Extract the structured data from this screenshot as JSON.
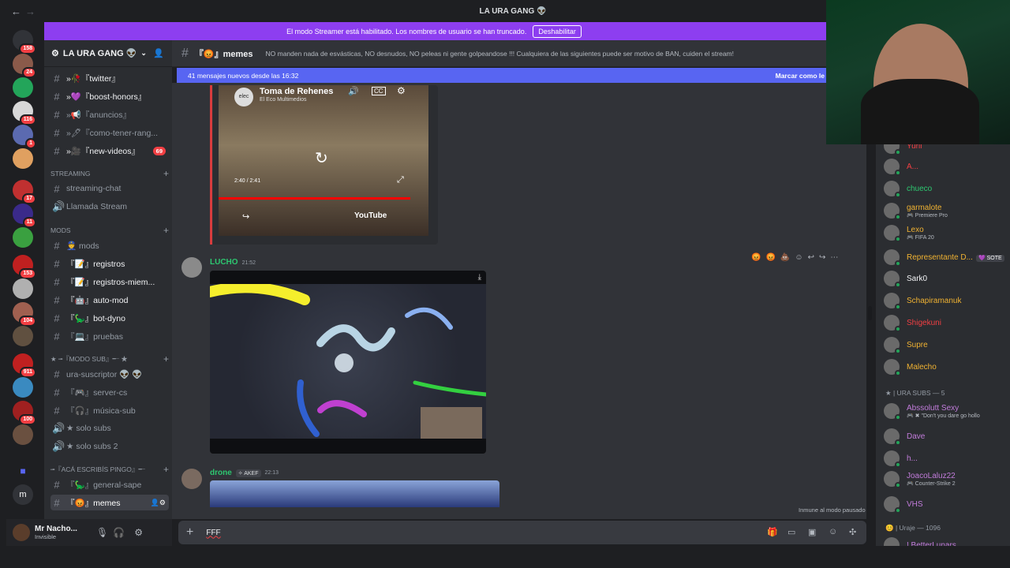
{
  "window": {
    "title": "LA URA GANG 👽",
    "back": "←",
    "forward": "→"
  },
  "banner": {
    "text": "El modo Streamer está habilitado. Los nombres de usuario se han truncado.",
    "button": "Deshabilitar"
  },
  "servers": [
    {
      "color": "#313338",
      "badge": "158"
    },
    {
      "color": "#8a5a4a",
      "badge": "24"
    },
    {
      "color": "#23a55a",
      "badge": ""
    },
    {
      "color": "#d8d8d8",
      "badge": "116"
    },
    {
      "color": "#5b6ab0",
      "badge": "1"
    },
    {
      "color": "#e0a060",
      "badge": ""
    },
    {
      "color": "#c03030",
      "badge": "17"
    },
    {
      "color": "#3a2a8a",
      "badge": "11"
    },
    {
      "color": "#3aa040",
      "badge": ""
    },
    {
      "color": "#c02020",
      "badge": "153"
    },
    {
      "color": "#b0b0b0",
      "badge": ""
    },
    {
      "color": "#a06050",
      "badge": "104"
    },
    {
      "color": "#605040",
      "badge": ""
    },
    {
      "color": "#c02020",
      "badge": "911"
    },
    {
      "color": "#3a8ac0",
      "badge": ""
    },
    {
      "color": "#a02020",
      "badge": "100"
    },
    {
      "color": "#6a5040",
      "badge": ""
    }
  ],
  "server": {
    "name": "LA URA GANG 👽"
  },
  "sidebar": {
    "channels": [
      {
        "label": "»🥀『twitter』",
        "bright": true,
        "badge": ""
      },
      {
        "label": "»💜『boost-honors』",
        "bright": true,
        "badge": ""
      },
      {
        "label": "»📢『anuncios』",
        "bright": false,
        "badge": ""
      },
      {
        "label": "»🖊『como-tener-rang...",
        "bright": false,
        "badge": ""
      },
      {
        "label": "»🎥『new-videos』",
        "bright": true,
        "badge": "69"
      }
    ],
    "streaming_cat": "STREAMING",
    "streaming": [
      {
        "label": "streaming-chat",
        "icon": "#"
      },
      {
        "label": "Llamada Stream",
        "icon": "🔊"
      }
    ],
    "mods_cat": "mods",
    "mods": [
      {
        "label": "👮 mods",
        "bright": false
      },
      {
        "label": "『📝』registros",
        "bright": true
      },
      {
        "label": "『📝』registros-miem...",
        "bright": true
      },
      {
        "label": "『🤖』auto-mod",
        "bright": true
      },
      {
        "label": "『🦕』bot-dyno",
        "bright": true
      },
      {
        "label": "『💻』pruebas",
        "bright": false
      }
    ],
    "modo_sub_cat": "★ ╼『MODO SUB』╾ ★",
    "modo_sub": [
      {
        "label": "ura-suscriptor 👽 👽",
        "icon": "#"
      },
      {
        "label": "『🎮』server-cs",
        "icon": "#"
      },
      {
        "label": "『🎧』música-sub",
        "icon": "#"
      },
      {
        "label": "★ solo subs",
        "icon": "🔊"
      },
      {
        "label": "★ solo subs 2",
        "icon": "🔊"
      }
    ],
    "aca_cat": "╼『acá escribís pingo』╾",
    "aca": [
      {
        "label": "『🦕』general-sape",
        "sel": false
      },
      {
        "label": "『😡』memes",
        "sel": true
      }
    ]
  },
  "user": {
    "name": "Mr Nacho...",
    "status": "Invisible"
  },
  "chat": {
    "channel": "『😡』memes",
    "topic": "NO manden nada de esvásticas, NO desnudos, NO peleas ni gente golpeandose !!! Cualquiera de las siguientes puede ser motivo de BAN, cuiden el stream!",
    "new_messages": "41 mensajes nuevos desde las 16:32",
    "mark_read": "Marcar como le",
    "yt": {
      "title": "Toma de Rehenes",
      "channel": "El Eco Multimedios",
      "logo": "elec",
      "time": "2:40 / 2:41",
      "brand": "YouTube"
    },
    "messages": [
      {
        "author": "LUCHO",
        "time": "21:52",
        "color": "#2dc770"
      },
      {
        "author": "drone",
        "tag": "✧ AKEF",
        "time": "22:13",
        "color": "#2dc770"
      }
    ],
    "input": "FFF",
    "immune": "Inmune al modo pausado"
  },
  "members": [
    {
      "name": "Yurii",
      "color": "#f23f43",
      "sub": ""
    },
    {
      "name": "A...",
      "color": "#f23f43",
      "sub": ""
    },
    {
      "name": "chueco",
      "color": "#2dc770",
      "sub": ""
    },
    {
      "name": "garmalote",
      "color": "#f0b232",
      "sub": "🎮 Premiere Pro"
    },
    {
      "name": "Lexo",
      "color": "#f0b232",
      "sub": "🎮 FIFA 20"
    },
    {
      "name": "Representante D...",
      "color": "#f0b232",
      "sub": "",
      "tag": "💜 SOTE"
    },
    {
      "name": "Sark0",
      "color": "#f2f3f5",
      "sub": ""
    },
    {
      "name": "Schapiramanuk",
      "color": "#f0b232",
      "sub": ""
    },
    {
      "name": "Shigekuni",
      "color": "#f23f43",
      "sub": ""
    },
    {
      "name": "Supre",
      "color": "#f0b232",
      "sub": ""
    },
    {
      "name": "Malecho",
      "color": "#f0b232",
      "sub": ""
    }
  ],
  "member_groups": {
    "ura_subs": "★ | URA SUBS — 5",
    "uraje": "😊 | Uraje — 1096"
  },
  "subs": [
    {
      "name": "Abssolutt Sexy",
      "color": "#c27cdb",
      "sub": "🎮 ✖ \"Don't you dare go hollo"
    },
    {
      "name": "Dave",
      "color": "#c27cdb",
      "sub": ""
    },
    {
      "name": "h...",
      "color": "#c27cdb",
      "sub": ""
    },
    {
      "name": "JoacoLaluz22",
      "color": "#c27cdb",
      "sub": "🎮 Counter-Strike 2"
    },
    {
      "name": "VHS",
      "color": "#c27cdb",
      "sub": ""
    }
  ],
  "uraje_first": "! BetterLunars"
}
